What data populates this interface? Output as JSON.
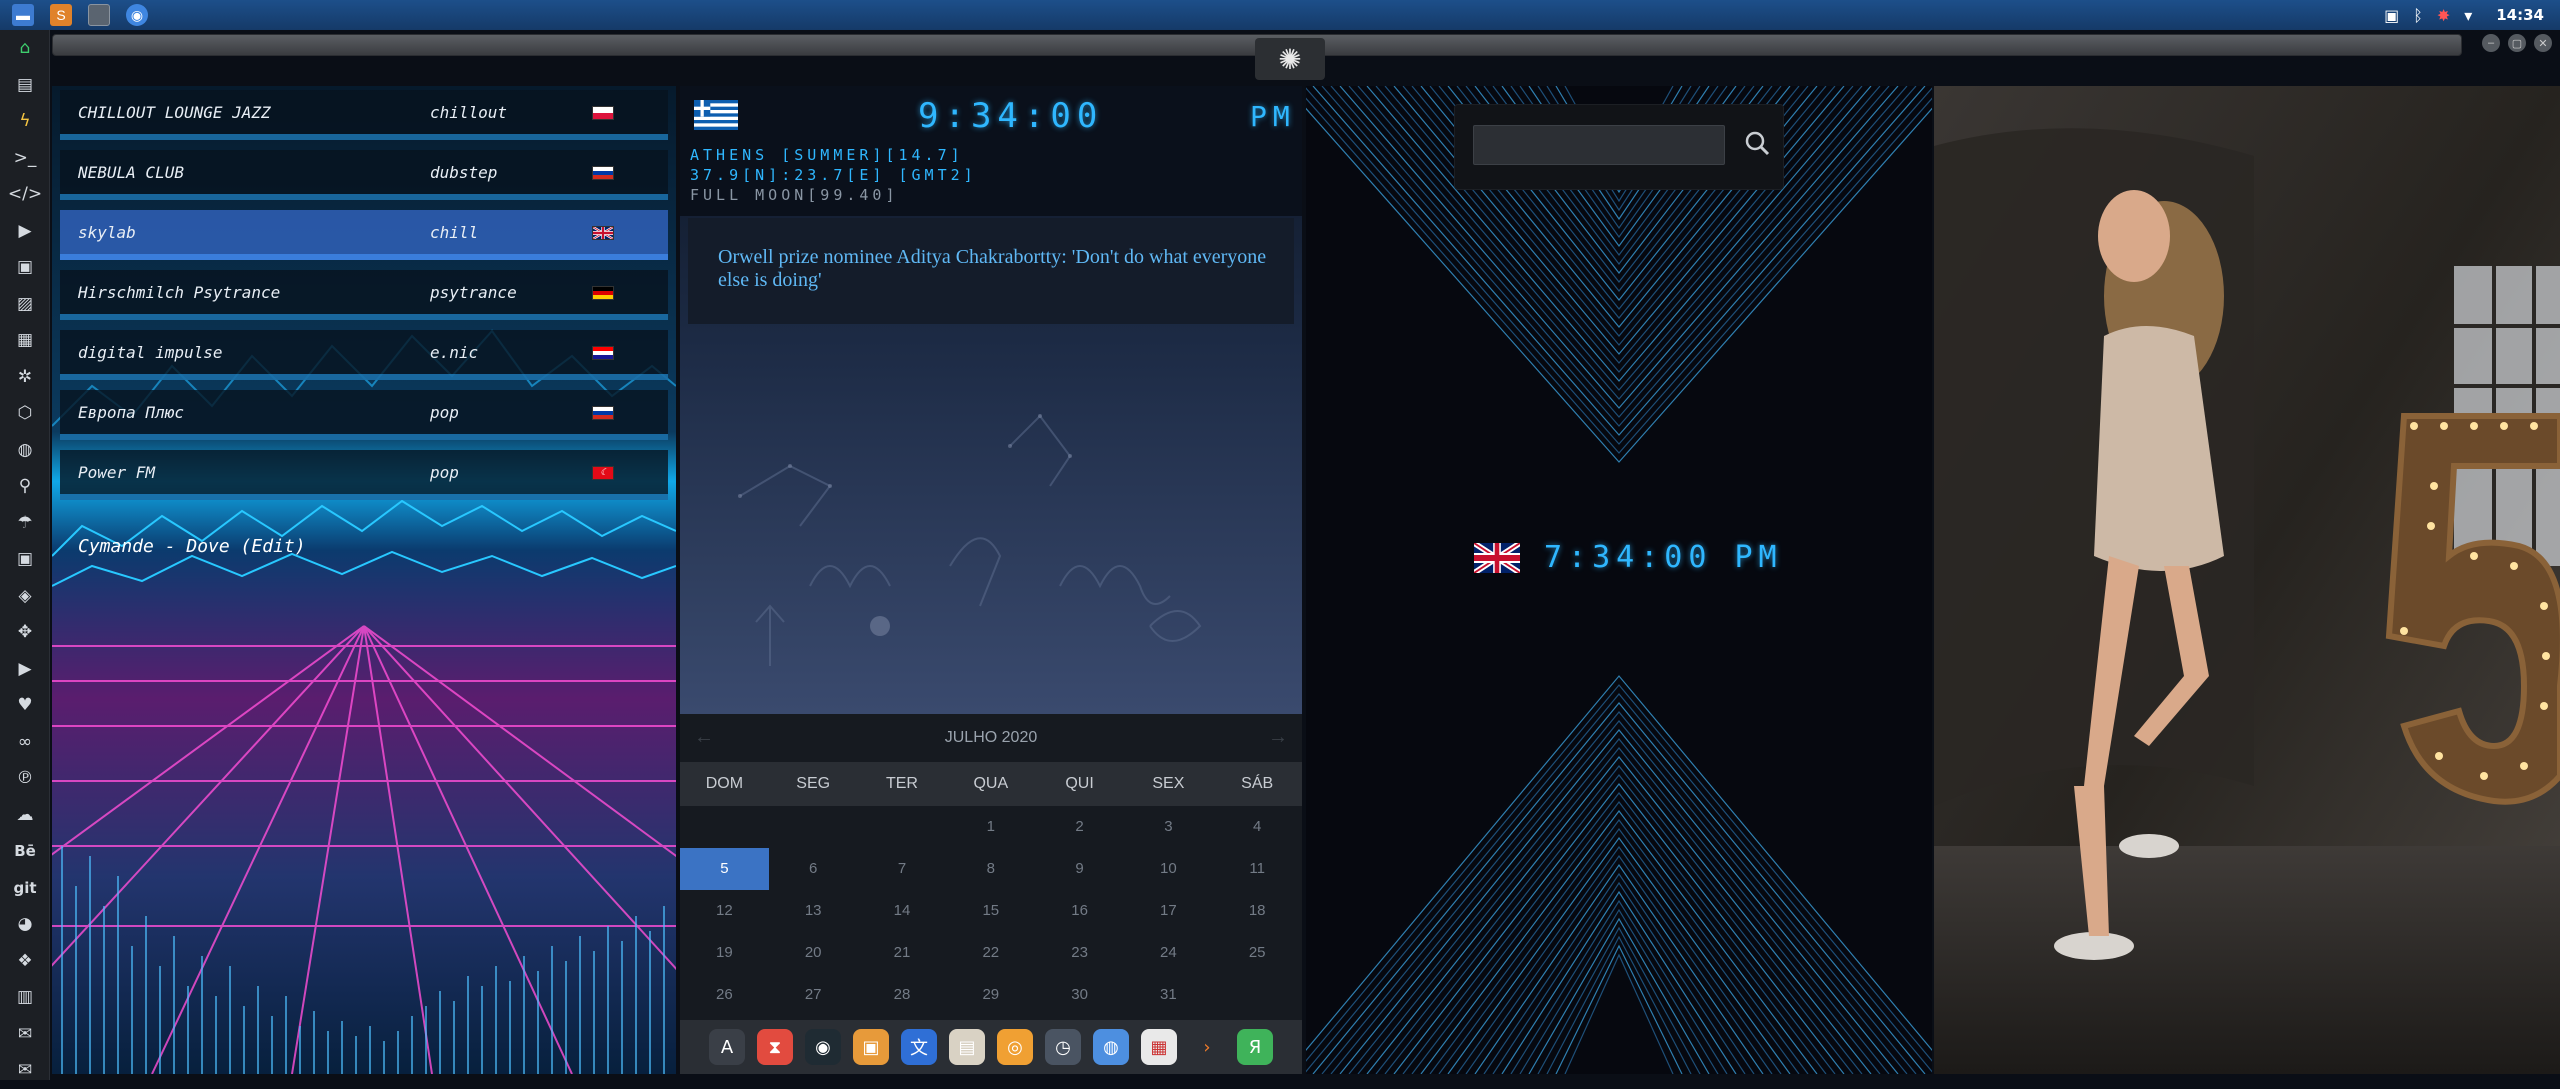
{
  "taskbar": {
    "launchers": [
      "files-app",
      "sublime-text",
      "window-switcher",
      "chrome-browser"
    ],
    "tray_time": "14:34"
  },
  "window": {
    "controls": [
      "minimize",
      "maximize",
      "close"
    ]
  },
  "sidebar_icons": [
    "home-icon",
    "document-icon",
    "bolt-icon",
    "terminal-icon",
    "code-icon",
    "play-icon",
    "media-icon",
    "image-icon",
    "news-icon",
    "settings-gear-icon",
    "hexagon-icon",
    "globe-icon",
    "search-icon",
    "umbrella-icon",
    "contact-icon",
    "tag-icon",
    "expand-icon",
    "youtube-icon",
    "heart-icon",
    "lastfm-icon",
    "pinterest-icon",
    "cloud-icon",
    "behance-icon",
    "git-icon",
    "github-icon",
    "dropbox-icon",
    "map-icon",
    "mail-icon",
    "envelope-icon"
  ],
  "sidebar_text": {
    "behance": "Bē",
    "git": "git"
  },
  "radio": {
    "stations": [
      {
        "name": "CHILLOUT LOUNGE JAZZ",
        "genre": "chillout",
        "flag": "poland"
      },
      {
        "name": "NEBULA CLUB",
        "genre": "dubstep",
        "flag": "russia"
      },
      {
        "name": "skylab",
        "genre": "chill",
        "flag": "uk"
      },
      {
        "name": "Hirschmilch Psytrance",
        "genre": "psytrance",
        "flag": "germany"
      },
      {
        "name": "digital impulse",
        "genre": "e.nic",
        "flag": "croatia"
      },
      {
        "name": "Европа Плюс",
        "genre": "pop",
        "flag": "russia"
      },
      {
        "name": "Power FM",
        "genre": "pop",
        "flag": "turkey"
      }
    ],
    "selected_index": 2,
    "now_playing": "Cymande - Dove (Edit)"
  },
  "clock": {
    "time": "9:34:00",
    "ampm": "PM",
    "location_line": "ATHENS [SUMMER][14.7]",
    "coords_line": "37.9[N]:23.7[E] [GMT2]",
    "moon_line": "FULL MOON[99.40]",
    "news": "Orwell prize nominee Aditya Chakrabortty: 'Don't do what everyone else is doing'"
  },
  "calendar": {
    "month": "JULHO 2020",
    "days": [
      "DOM",
      "SEG",
      "TER",
      "QUA",
      "QUI",
      "SEX",
      "SÁB"
    ],
    "weeks": [
      [
        "",
        "",
        "",
        "1",
        "2",
        "3",
        "4"
      ],
      [
        "5",
        "6",
        "7",
        "8",
        "9",
        "10",
        "11"
      ],
      [
        "12",
        "13",
        "14",
        "15",
        "16",
        "17",
        "18"
      ],
      [
        "19",
        "20",
        "21",
        "22",
        "23",
        "24",
        "25"
      ],
      [
        "26",
        "27",
        "28",
        "29",
        "30",
        "31",
        ""
      ]
    ],
    "today": "5"
  },
  "dock_apps": [
    "app-a-icon",
    "hourglass-icon",
    "orb-icon",
    "photos-icon",
    "translate-icon",
    "notes-icon",
    "search-app-icon",
    "clock-app-icon",
    "globe-app-icon",
    "calendar-app-icon",
    "arrow-app-icon",
    "yandex-icon"
  ],
  "dock_glyphs": [
    "A",
    "⧗",
    "◉",
    "▣",
    "文",
    "▤",
    "◎",
    "◷",
    "◍",
    "▦",
    "›",
    "Я"
  ],
  "search": {
    "value": ""
  },
  "world_clock": {
    "time": "7:34:00",
    "ampm": "PM",
    "flag": "uk"
  },
  "colors": {
    "accent": "#2fb7ff",
    "selected_station": "#2e5fb4",
    "calendar_today": "#3b73c4",
    "sidebar_active": "#3ecf6e"
  }
}
